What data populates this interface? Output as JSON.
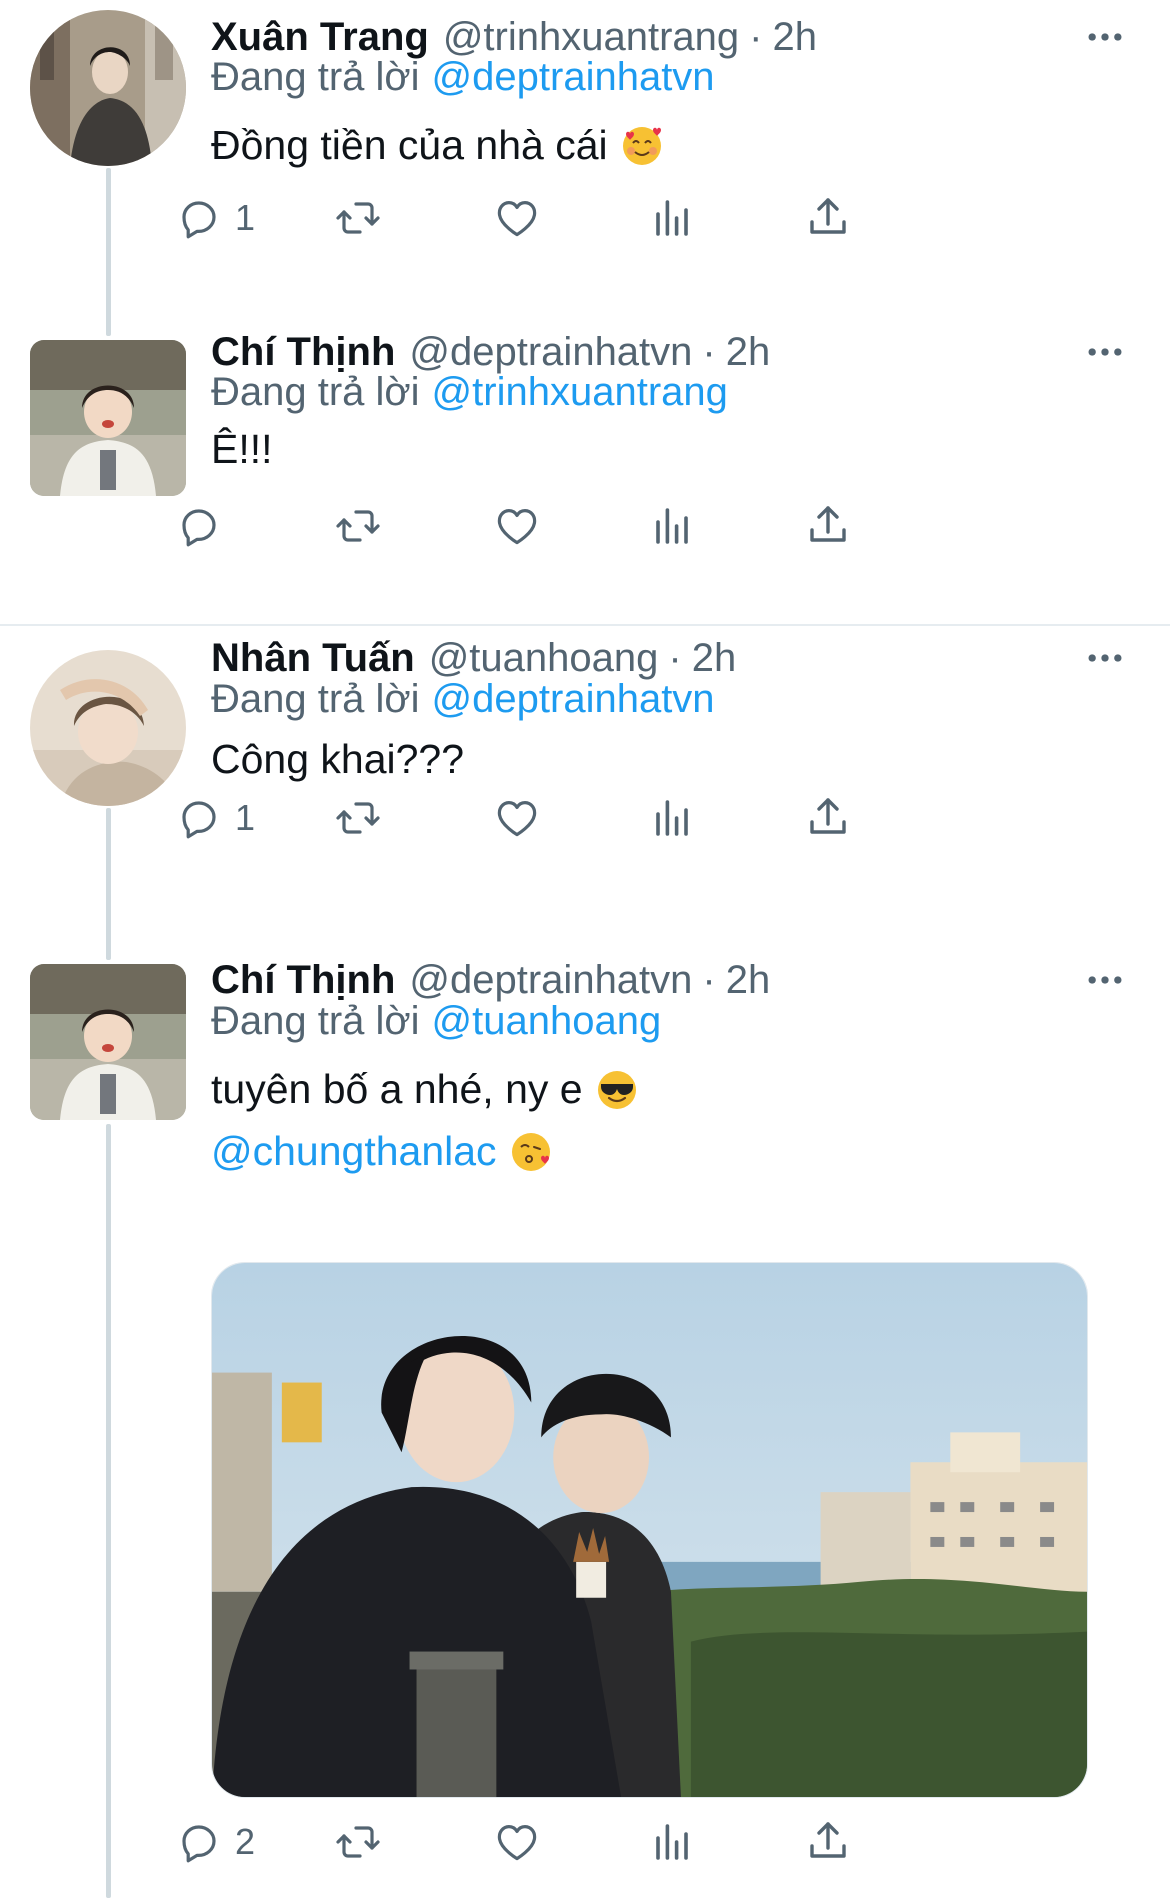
{
  "reply_prefix": "Đang trả lời",
  "tweets": [
    {
      "name": "Xuân Trang",
      "handle": "@trinhxuantrang",
      "separator": "·",
      "time": "2h",
      "reply_to": "@deptrainhatvn",
      "text": "Đồng tiền của nhà cái",
      "emoji": "smiling-face-with-hearts",
      "reply_count": "1",
      "retweet_count": "",
      "like_count": ""
    },
    {
      "name": "Chí Thịnh",
      "handle": "@deptrainhatvn",
      "separator": "·",
      "time": "2h",
      "reply_to": "@trinhxuantrang",
      "text": "Ê!!!",
      "reply_count": "",
      "retweet_count": "",
      "like_count": ""
    },
    {
      "name": "Nhân Tuấn",
      "handle": "@tuanhoang",
      "separator": "·",
      "time": "2h",
      "reply_to": "@deptrainhatvn",
      "text": "Công khai???",
      "reply_count": "1",
      "retweet_count": "",
      "like_count": ""
    },
    {
      "name": "Chí Thịnh",
      "handle": "@deptrainhatvn",
      "separator": "·",
      "time": "2h",
      "reply_to": "@tuanhoang",
      "text": "tuyên bố a nhé, ny e",
      "emoji": "smiling-face-with-sunglasses",
      "mention_line": "@chungthanlac",
      "mention_emoji": "face-blowing-a-kiss",
      "reply_count": "2",
      "retweet_count": "",
      "like_count": ""
    }
  ],
  "icons": {
    "reply": "reply-icon",
    "retweet": "retweet-icon",
    "like": "heart-icon",
    "analytics": "analytics-icon",
    "share": "share-icon",
    "more": "more-icon"
  },
  "colors": {
    "link": "#1d9bf0",
    "secondary_text": "#536471",
    "primary_text": "#0f1419",
    "icon": "#536471",
    "thread_line": "#cfd9de"
  }
}
